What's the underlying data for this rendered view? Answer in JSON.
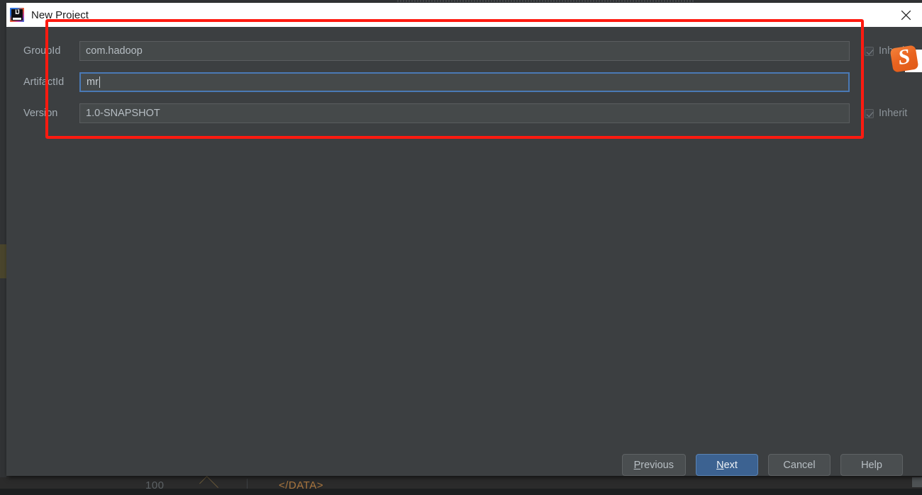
{
  "window": {
    "title": "New Project",
    "app_icon": "intellij-idea-icon",
    "close_icon": "close-icon"
  },
  "form": {
    "fields": [
      {
        "label": "GroupId",
        "value": "com.hadoop",
        "focused": false,
        "inherit_label": "Inherit",
        "inherit_checked": true
      },
      {
        "label": "ArtifactId",
        "value": "mr",
        "focused": true,
        "inherit_label": "",
        "inherit_checked": false
      },
      {
        "label": "Version",
        "value": "1.0-SNAPSHOT",
        "focused": false,
        "inherit_label": "Inherit",
        "inherit_checked": true
      }
    ]
  },
  "buttons": {
    "previous": {
      "label_before": "",
      "mnemonic": "P",
      "label_after": "revious"
    },
    "next": {
      "label_before": "",
      "mnemonic": "N",
      "label_after": "ext"
    },
    "cancel": {
      "label": "Cancel"
    },
    "help": {
      "label": "Help"
    }
  },
  "ime": {
    "badge_letter": "S",
    "name": "sogou-ime-badge"
  },
  "annotation": {
    "shape": "rectangle",
    "color": "#ff1a10"
  },
  "background_editor": {
    "line_number": "100",
    "tag_text": "</DATA>"
  },
  "colors": {
    "dialog_bg": "#3c3f41",
    "field_bg": "#45494a",
    "titlebar_bg": "#ffffff",
    "accent_blue": "#3c6291",
    "focus_border": "#4a79b5",
    "annotation_red": "#ff1a10",
    "ime_orange": "#ea6420"
  }
}
